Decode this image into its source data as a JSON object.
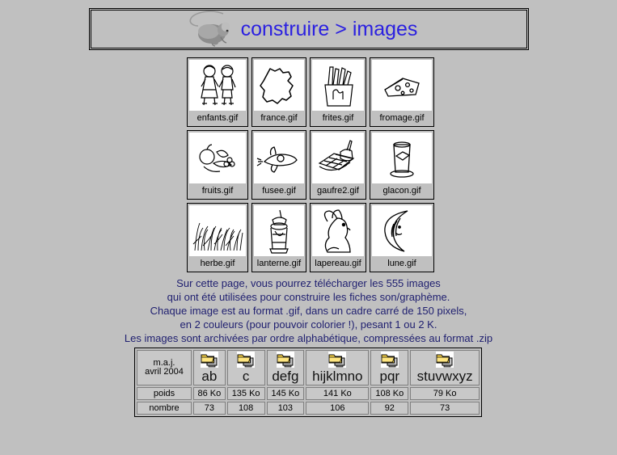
{
  "header": {
    "title": "construire > images",
    "mouse_icon": "mouse-icon",
    "title_color": "#2b20e0"
  },
  "gallery": {
    "rows": [
      [
        {
          "file": "enfants.gif",
          "icon": "children-drawing"
        },
        {
          "file": "france.gif",
          "icon": "france-map-drawing"
        },
        {
          "file": "frites.gif",
          "icon": "fries-drawing"
        },
        {
          "file": "fromage.gif",
          "icon": "cheese-drawing"
        }
      ],
      [
        {
          "file": "fruits.gif",
          "icon": "fruits-drawing"
        },
        {
          "file": "fusee.gif",
          "icon": "rocket-drawing"
        },
        {
          "file": "gaufre2.gif",
          "icon": "waffle-drawing"
        },
        {
          "file": "glacon.gif",
          "icon": "ice-cube-glass-drawing"
        }
      ],
      [
        {
          "file": "herbe.gif",
          "icon": "grass-drawing"
        },
        {
          "file": "lanterne.gif",
          "icon": "lantern-drawing"
        },
        {
          "file": "lapereau.gif",
          "icon": "rabbit-drawing"
        },
        {
          "file": "lune.gif",
          "icon": "moon-drawing"
        }
      ]
    ]
  },
  "blurb": {
    "line1": "Sur cette page, vous pourrez télécharger les 555 images",
    "line2": "qui ont été utilisées pour construire les fiches son/graphème.",
    "line3": "Chaque image est au format .gif, dans un cadre carré de 150 pixels,",
    "line4": "en 2 couleurs (pour pouvoir colorier !), pesant 1 ou 2 K.",
    "line5": "Les images sont archivées par ordre alphabétique, compressées au format .zip",
    "text_color": "#202070"
  },
  "download_table": {
    "update_label_line1": "m.a.j.",
    "update_label_line2": "avril 2004",
    "update_color": "#8b2020",
    "icon_name": "download-folder-icon",
    "columns": [
      {
        "letters": "ab",
        "poids": "86 Ko",
        "nombre": "73"
      },
      {
        "letters": "c",
        "poids": "135 Ko",
        "nombre": "108"
      },
      {
        "letters": "defg",
        "poids": "145 Ko",
        "nombre": "103"
      },
      {
        "letters": "hijklmno",
        "poids": "141 Ko",
        "nombre": "106"
      },
      {
        "letters": "pqr",
        "poids": "108 Ko",
        "nombre": "92"
      },
      {
        "letters": "stuvwxyz",
        "poids": "79 Ko",
        "nombre": "73"
      }
    ],
    "row_labels": {
      "poids": "poids",
      "nombre": "nombre"
    }
  }
}
